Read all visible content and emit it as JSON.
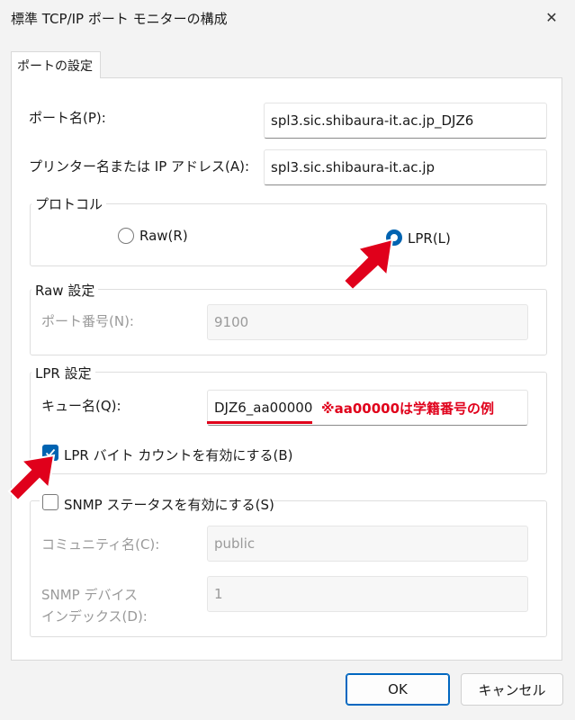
{
  "window": {
    "title": "標準 TCP/IP ポート モニターの構成",
    "close_glyph": "✕"
  },
  "tab": {
    "label": "ポートの設定"
  },
  "port_name": {
    "label": "ポート名(P):",
    "value": "spl3.sic.shibaura-it.ac.jp_DJZ6"
  },
  "printer_address": {
    "label": "プリンター名または IP アドレス(A):",
    "value": "spl3.sic.shibaura-it.ac.jp"
  },
  "protocol": {
    "title": "プロトコル",
    "raw_label": "Raw(R)",
    "lpr_label": "LPR(L)",
    "selected": "LPR"
  },
  "raw_settings": {
    "title": "Raw 設定",
    "port_number_label": "ポート番号(N):",
    "port_number_value": "9100"
  },
  "lpr_settings": {
    "title": "LPR 設定",
    "queue_label": "キュー名(Q):",
    "queue_value": "DJZ6_aa00000",
    "annotation": "※aa00000は学籍番号の例",
    "byte_count_label": "LPR バイト カウントを有効にする(B)",
    "byte_count_checked": true
  },
  "snmp": {
    "checkbox_label": "SNMP ステータスを有効にする(S)",
    "checked": false,
    "community_label": "コミュニティ名(C):",
    "community_value": "public",
    "device_index_label_line1": "SNMP デバイス",
    "device_index_label_line2": "インデックス(D):",
    "device_index_value": "1"
  },
  "buttons": {
    "ok": "OK",
    "cancel": "キャンセル"
  },
  "colors": {
    "accent": "#0063b1",
    "annotation_red": "#e0001b"
  }
}
